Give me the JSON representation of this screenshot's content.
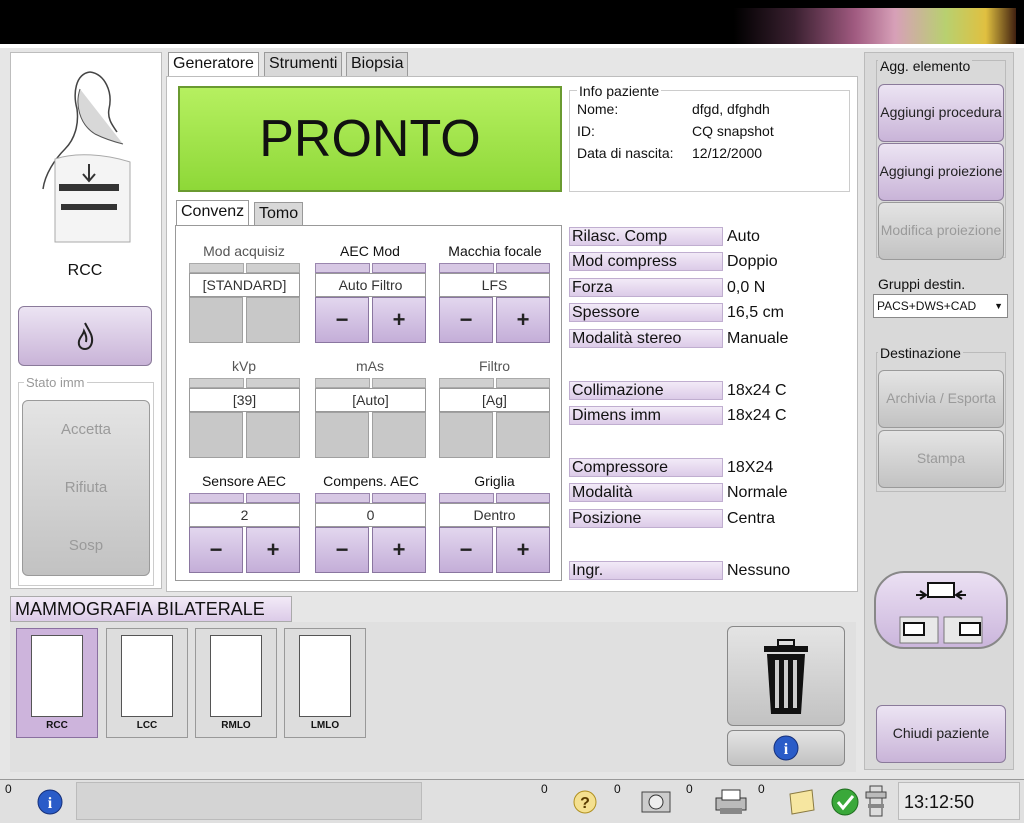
{
  "tabs": {
    "generatore": "Generatore",
    "strumenti": "Strumenti",
    "biopsia": "Biopsia"
  },
  "status_display": "PRONTO",
  "patient": {
    "title": "Info paziente",
    "name_label": "Nome:",
    "name_value": "dfgd, dfghdh",
    "id_label": "ID:",
    "id_value": "CQ snapshot",
    "dob_label": "Data di nascita:",
    "dob_value": "12/12/2000"
  },
  "view": {
    "label": "RCC"
  },
  "image_state": {
    "title": "Stato imm",
    "accept": "Accetta",
    "reject": "Rifiuta",
    "hold": "Sosp"
  },
  "subtabs": {
    "convenz": "Convenz",
    "tomo": "Tomo"
  },
  "controls": {
    "mod_acquisiz": {
      "label": "Mod acquisiz",
      "value": "[STANDARD]"
    },
    "aec_mod": {
      "label": "AEC Mod",
      "value": "Auto Filtro"
    },
    "macchia": {
      "label": "Macchia focale",
      "value": "LFS"
    },
    "kvp": {
      "label": "kVp",
      "value": "[39]"
    },
    "mas": {
      "label": "mAs",
      "value": "[Auto]"
    },
    "filtro": {
      "label": "Filtro",
      "value": "[Ag]"
    },
    "sensore": {
      "label": "Sensore AEC",
      "value": "2"
    },
    "compens": {
      "label": "Compens. AEC",
      "value": "0"
    },
    "griglia": {
      "label": "Griglia",
      "value": "Dentro"
    },
    "minus": "−",
    "plus": "+"
  },
  "properties": [
    {
      "label": "Rilasc. Comp",
      "value": "Auto"
    },
    {
      "label": "Mod compress",
      "value": "Doppio"
    },
    {
      "label": "Forza",
      "value": "0,0 N"
    },
    {
      "label": "Spessore",
      "value": "16,5 cm"
    },
    {
      "label": "Modalità stereo",
      "value": "Manuale"
    },
    {
      "label": "Collimazione",
      "value": "18x24 C"
    },
    {
      "label": "Dimens imm",
      "value": "18x24 C"
    },
    {
      "label": "Compressore",
      "value": "18X24"
    },
    {
      "label": "Modalità",
      "value": "Normale"
    },
    {
      "label": "Posizione",
      "value": "Centra"
    },
    {
      "label": "Ingr.",
      "value": "Nessuno"
    }
  ],
  "procedure": {
    "title": "MAMMOGRAFIA  BILATERALE",
    "thumbs": [
      "RCC",
      "LCC",
      "RMLO",
      "LMLO"
    ]
  },
  "right": {
    "add_title": "Agg. elemento",
    "add_procedure": "Aggiungi procedura",
    "add_view": "Aggiungi proiezione",
    "edit_view": "Modifica proiezione",
    "groups_title": "Gruppi destin.",
    "groups_value": "PACS+DWS+CAD",
    "dest_title": "Destinazione",
    "archive": "Archivia / Esporta",
    "print": "Stampa",
    "close_patient": "Chiudi paziente"
  },
  "status": {
    "count_left": "0",
    "count_help": "0",
    "count_media": "0",
    "count_print": "0",
    "count_notes": "0",
    "time": "13:12:50"
  }
}
